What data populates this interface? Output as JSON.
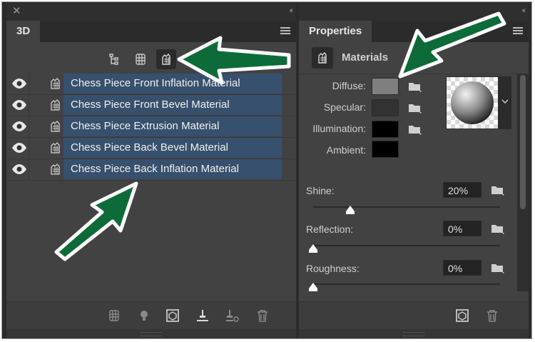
{
  "panel3d": {
    "tab": "3D",
    "rows": [
      {
        "label": "Chess Piece Front Inflation Material"
      },
      {
        "label": "Chess Piece Front Bevel Material"
      },
      {
        "label": "Chess Piece Extrusion Material"
      },
      {
        "label": "Chess Piece Back Bevel Material"
      },
      {
        "label": "Chess Piece Back Inflation Material"
      }
    ]
  },
  "properties": {
    "tab": "Properties",
    "section_title": "Materials",
    "labels": {
      "diffuse": "Diffuse:",
      "specular": "Specular:",
      "illumination": "Illumination:",
      "ambient": "Ambient:",
      "shine": "Shine:",
      "reflection": "Reflection:",
      "roughness": "Roughness:"
    },
    "values": {
      "shine": "20%",
      "reflection": "0%",
      "roughness": "0%"
    },
    "slider_levels": {
      "shine": 0.2,
      "reflection": 0,
      "roughness": 0
    },
    "swatch_colors": {
      "diffuse": "#7f7f7f",
      "specular": "#323232",
      "illumination": "#000000",
      "ambient": "#000000"
    }
  },
  "colors": {
    "selection": "#37506d",
    "arrow": "#0d6b3a"
  }
}
